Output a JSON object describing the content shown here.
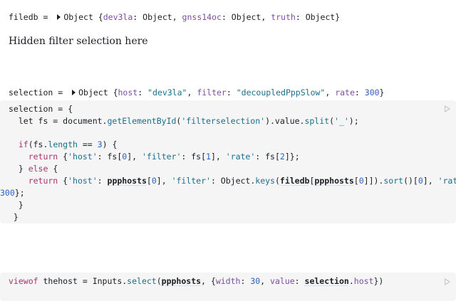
{
  "output_filedb": {
    "name": "filedb",
    "eq": " = ",
    "type": "Object",
    "open": " {",
    "entries": [
      {
        "key": "dev3la",
        "val": "Object"
      },
      {
        "key": "gnss14oc",
        "val": "Object"
      },
      {
        "key": "truth",
        "val": "Object"
      }
    ],
    "close": "}"
  },
  "hidden_filter_text": "Hidden filter selection here",
  "output_selection": {
    "name": "selection",
    "eq": " = ",
    "type": "Object",
    "open": " {",
    "host_key": "host",
    "host_val": "\"dev3la\"",
    "filter_key": "filter",
    "filter_val": "\"decoupledPppSlow\"",
    "rate_key": "rate",
    "rate_val": "300",
    "close": "}"
  },
  "code_cell_1": {
    "l1_a": "selection = {",
    "l2_a": "  let fs = document.",
    "l2_b": "getElementById",
    "l2_c": "(",
    "l2_d": "'filterselection'",
    "l2_e": ").value.",
    "l2_f": "split",
    "l2_g": "(",
    "l2_h": "'_'",
    "l2_i": ");",
    "l4_a": "  if",
    "l4_b": "(fs.",
    "l4_c": "length",
    "l4_d": " == ",
    "l4_e": "3",
    "l4_f": ") {",
    "l5_a": "    return",
    "l5_b": " {",
    "l5_c": "'host'",
    "l5_d": ": fs[",
    "l5_e": "0",
    "l5_f": "], ",
    "l5_g": "'filter'",
    "l5_h": ": fs[",
    "l5_i": "1",
    "l5_j": "], ",
    "l5_k": "'rate'",
    "l5_l": ": fs[",
    "l5_m": "2",
    "l5_n": "]};",
    "l6_a": "  } ",
    "l6_b": "else",
    "l6_c": " {",
    "l7_a": "    return",
    "l7_b": " {",
    "l7_c": "'host'",
    "l7_d": ": ",
    "l7_e": "ppphosts",
    "l7_f": "[",
    "l7_g": "0",
    "l7_h": "], ",
    "l7_i": "'filter'",
    "l7_j": ": Object.",
    "l7_k": "keys",
    "l7_l": "(",
    "l7_m": "filedb",
    "l7_n": "[",
    "l7_o": "ppphosts",
    "l7_p": "[",
    "l7_q": "0",
    "l7_r": "]]).",
    "l7_s": "sort",
    "l7_t": "()[",
    "l7_u": "0",
    "l7_v": "], ",
    "l7_w": "'rate'",
    "l7_x": ":",
    "l8_a": "300",
    "l8_b": "};",
    "l9_a": "  }",
    "l10_a": " }"
  },
  "code_cell_2": {
    "a": "viewof",
    "b": " thehost = Inputs.",
    "c": "select",
    "d": "(",
    "e": "ppphosts",
    "f": ", {",
    "g": "width",
    "h": ": ",
    "i": "30",
    "j": ", ",
    "k": "value",
    "l": ": ",
    "m": "selection",
    "n": ".",
    "o": "host",
    "p": "})"
  }
}
